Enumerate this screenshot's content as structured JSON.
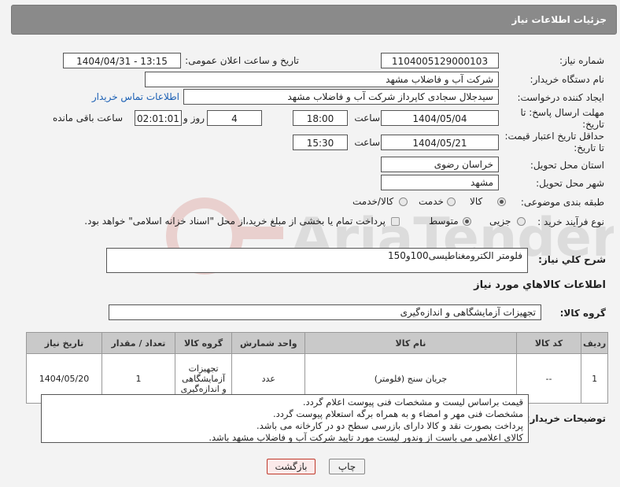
{
  "header": {
    "title": "جزئیات اطلاعات نیاز"
  },
  "fields": {
    "need_number_label": "شماره نیاز:",
    "need_number": "1104005129000103",
    "announce_label": "تاریخ و ساعت اعلان عمومی:",
    "announce_value": "1404/04/31 - 13:15",
    "buyer_org_label": "نام دستگاه خریدار:",
    "buyer_org": "شرکت آب و فاضلاب مشهد",
    "requester_label": "ایجاد کننده درخواست:",
    "requester": "سیدجلال سجادی کاپرداز شرکت آب و فاضلاب مشهد",
    "contact_link": "اطلاعات تماس خریدار",
    "reply_deadline_label": "مهلت ارسال پاسخ: تا تاریخ:",
    "reply_date": "1404/05/04",
    "time_label": "ساعت",
    "reply_time": "18:00",
    "days_value": "4",
    "days_label": "روز و",
    "remaining_time": "02:01:01",
    "remaining_label": "ساعت باقی مانده",
    "validity_label": "حداقل تاریخ اعتبار قیمت: تا تاریخ:",
    "validity_date": "1404/05/21",
    "validity_time": "15:30",
    "province_label": "استان محل تحویل:",
    "province": "خراسان رضوی",
    "city_label": "شهر محل تحویل:",
    "city": "مشهد",
    "category_label": "طبقه بندی موضوعی:",
    "category_options": [
      "کالا",
      "خدمت",
      "کالا/خدمت"
    ],
    "process_label": "نوع فرآیند خرید :",
    "process_options": [
      "جزیی",
      "متوسط"
    ],
    "payment_note": "پرداخت تمام یا بخشی از مبلغ خرید،از محل \"اسناد خزانه اسلامی\" خواهد بود."
  },
  "summary": {
    "label": "شرح کلي نياز:",
    "value": "فلومتر الکترومغناطیسی100و150"
  },
  "goods": {
    "section_title": "اطلاعات کالاهاي مورد نياز",
    "group_label": "گروه کالا:",
    "group_value": "تجهیزات آزمایشگاهی و اندازه‌گیری"
  },
  "table": {
    "headers": [
      "ردیف",
      "کد کالا",
      "نام کالا",
      "واحد شمارش",
      "گروه کالا",
      "تعداد / مقدار",
      "تاریخ نیاز"
    ],
    "rows": [
      [
        "1",
        "--",
        "جریان سنج (فلومتر)",
        "عدد",
        "تجهیزات آزمایشگاهی و اندازه‌گیری",
        "1",
        "1404/05/20"
      ]
    ]
  },
  "buyer_notes": {
    "label": "توضیحات خریدار:",
    "lines": [
      "قیمت براساس لیست و مشخصات فنی پیوست اعلام گردد.",
      "مشخصات فنی مهر و امضاء و به همراه برگه استعلام پیوست گردد.",
      "پرداخت بصورت نقد و کالا دارای بازرسی سطح دو در کارخانه می باشد.",
      "کالای اعلامی می باست از وندور لیست مورد تایید شرکت آب و فاضلاب مشهد باشد."
    ]
  },
  "buttons": {
    "print": "چاپ",
    "back": "بازگشت"
  },
  "colors": {
    "header_bg": "#8a8a8a",
    "link": "#1a5fb4",
    "table_header": "#c9c9c9",
    "back_btn_border": "#c0392b"
  }
}
